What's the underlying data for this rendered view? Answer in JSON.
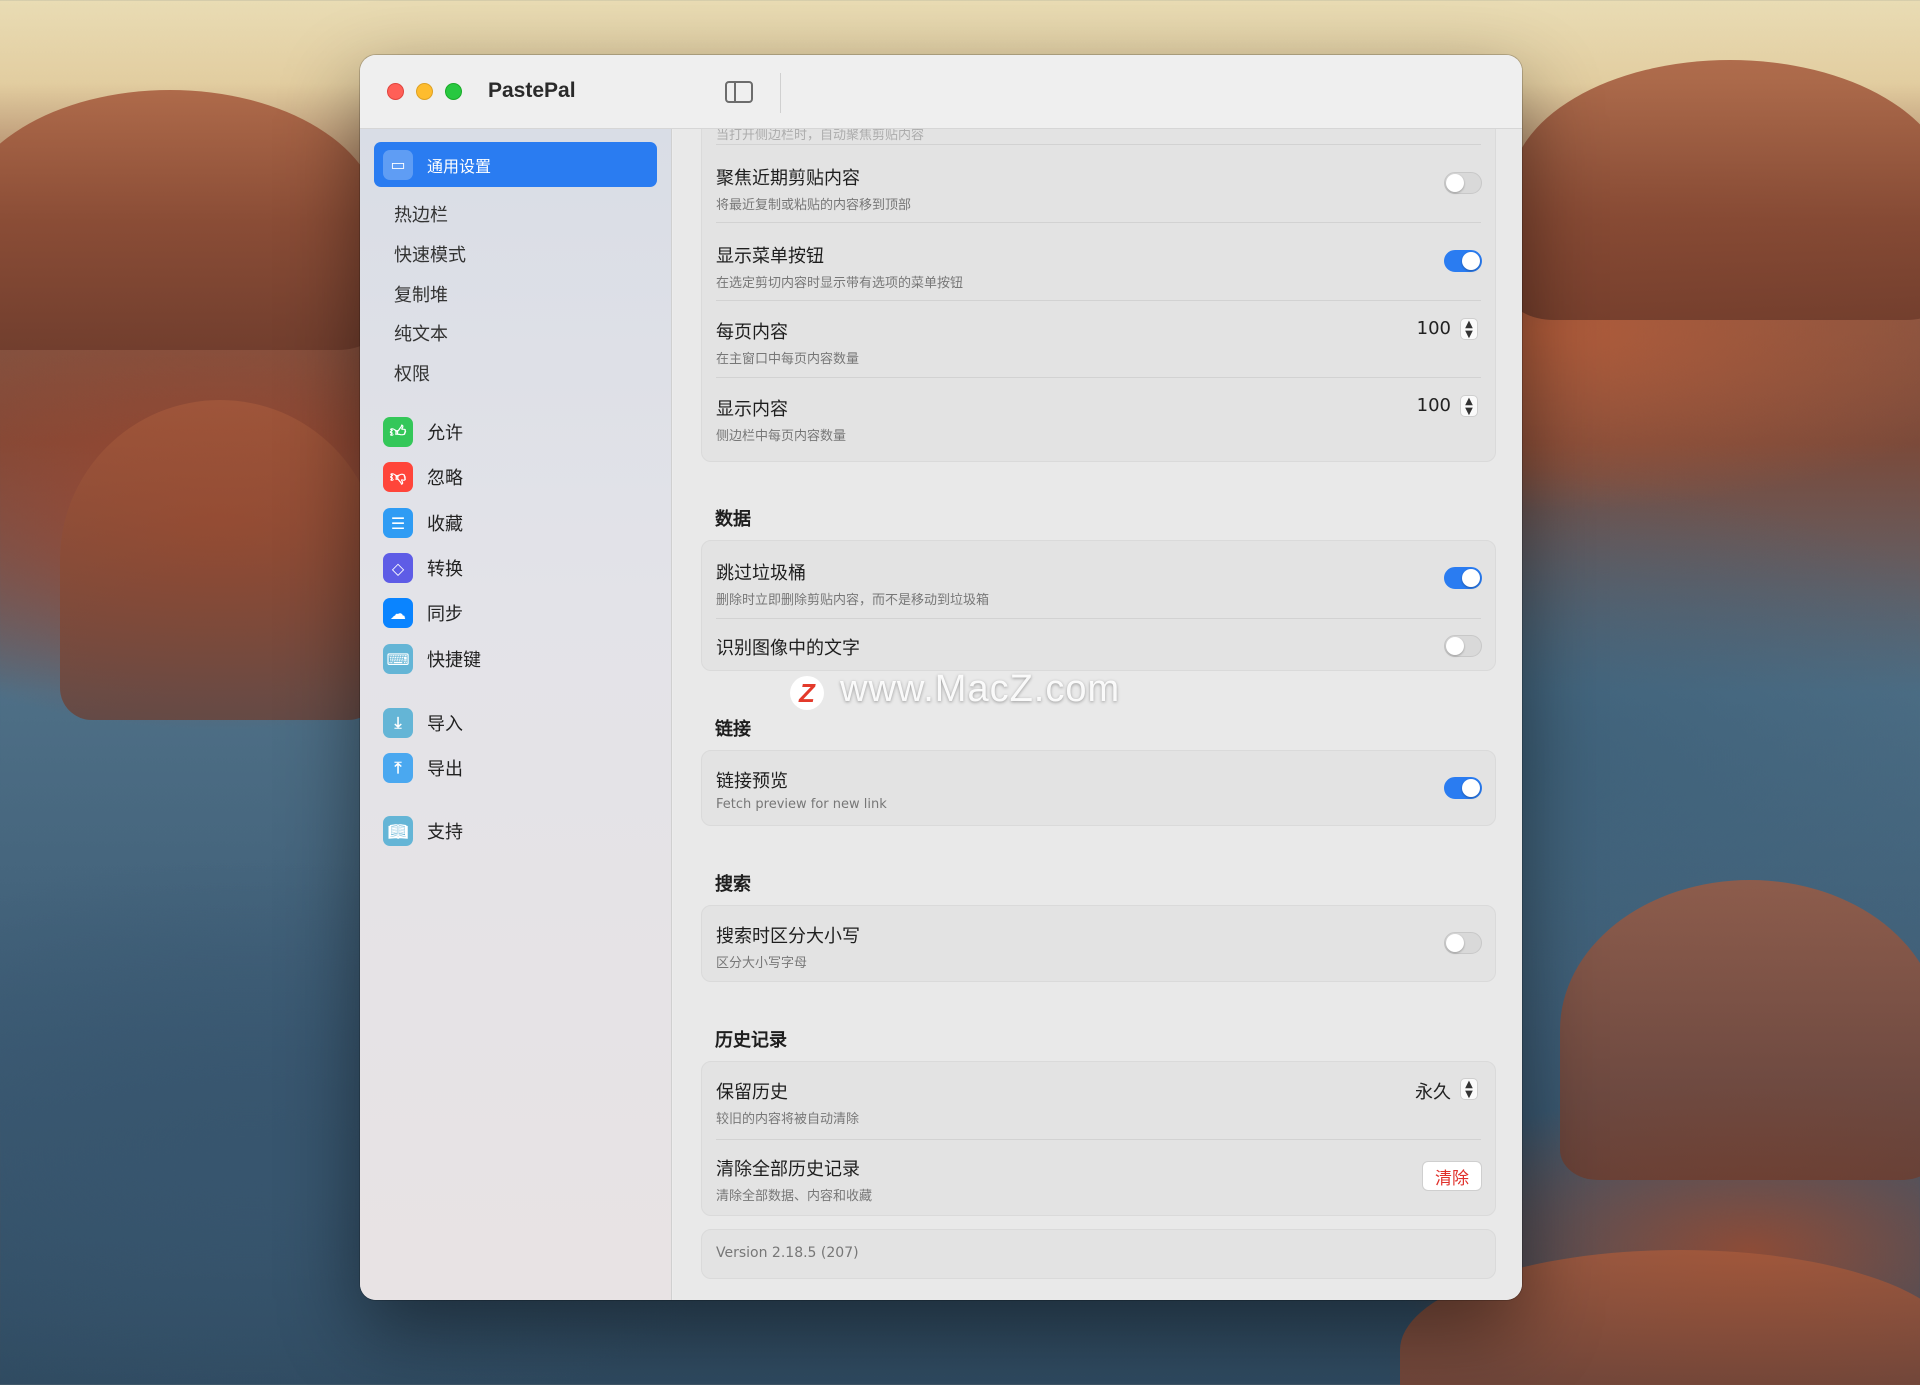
{
  "app": {
    "title": "PastePal"
  },
  "sidebar": {
    "active": {
      "label": "通用设置",
      "icon": "window-icon"
    },
    "sub_items": [
      {
        "label": "热边栏"
      },
      {
        "label": "快速模式"
      },
      {
        "label": "复制堆"
      },
      {
        "label": "纯文本"
      },
      {
        "label": "权限"
      }
    ],
    "items": [
      {
        "label": "允许",
        "icon": "thumbs-up-icon",
        "color": "#34c759"
      },
      {
        "label": "忽略",
        "icon": "thumbs-down-icon",
        "color": "#ff453a"
      },
      {
        "label": "收藏",
        "icon": "list-icon",
        "color": "#2f9cf4"
      },
      {
        "label": "转换",
        "icon": "shape-icon",
        "color": "#5e5ce6"
      },
      {
        "label": "同步",
        "icon": "cloud-icon",
        "color": "#0a84ff"
      },
      {
        "label": "快捷键",
        "icon": "keyboard-icon",
        "color": "#64b5d6"
      },
      {
        "label": "导入",
        "icon": "import-icon",
        "color": "#64b5d6"
      },
      {
        "label": "导出",
        "icon": "export-icon",
        "color": "#4aa8f0"
      },
      {
        "label": "支持",
        "icon": "book-icon",
        "color": "#64b5d6"
      }
    ]
  },
  "general": {
    "top_partial": "当打开侧边栏时，自动聚焦剪贴内容",
    "rows": [
      {
        "title": "聚焦近期剪贴内容",
        "subtitle": "将最近复制或粘贴的内容移到顶部",
        "toggle": false
      },
      {
        "title": "显示菜单按钮",
        "subtitle": "在选定剪切内容时显示带有选项的菜单按钮",
        "toggle": true
      },
      {
        "title": "每页内容",
        "subtitle": "在主窗口中每页内容数量",
        "value": "100"
      },
      {
        "title": "显示内容",
        "subtitle": "侧边栏中每页内容数量",
        "value": "100"
      }
    ]
  },
  "data_section": {
    "header": "数据",
    "rows": [
      {
        "title": "跳过垃圾桶",
        "subtitle": "删除时立即删除剪贴内容，而不是移动到垃圾箱",
        "toggle": true
      },
      {
        "title": "识别图像中的文字",
        "toggle": false
      }
    ]
  },
  "links_section": {
    "header": "链接",
    "rows": [
      {
        "title": "链接预览",
        "subtitle": "Fetch preview for new link",
        "toggle": true
      }
    ]
  },
  "search_section": {
    "header": "搜索",
    "rows": [
      {
        "title": "搜索时区分大小写",
        "subtitle": "区分大小写字母",
        "toggle": false
      }
    ]
  },
  "history_section": {
    "header": "历史记录",
    "rows": [
      {
        "title": "保留历史",
        "subtitle": "较旧的内容将被自动清除",
        "value": "永久"
      },
      {
        "title": "清除全部历史记录",
        "subtitle": "清除全部数据、内容和收藏",
        "button": "清除"
      }
    ]
  },
  "version": "Version 2.18.5 (207)",
  "watermark": {
    "text": "www.MacZ.com",
    "logo": "Z"
  },
  "colors": {
    "accent": "#2a7cf1",
    "destructive": "#e0302a"
  }
}
